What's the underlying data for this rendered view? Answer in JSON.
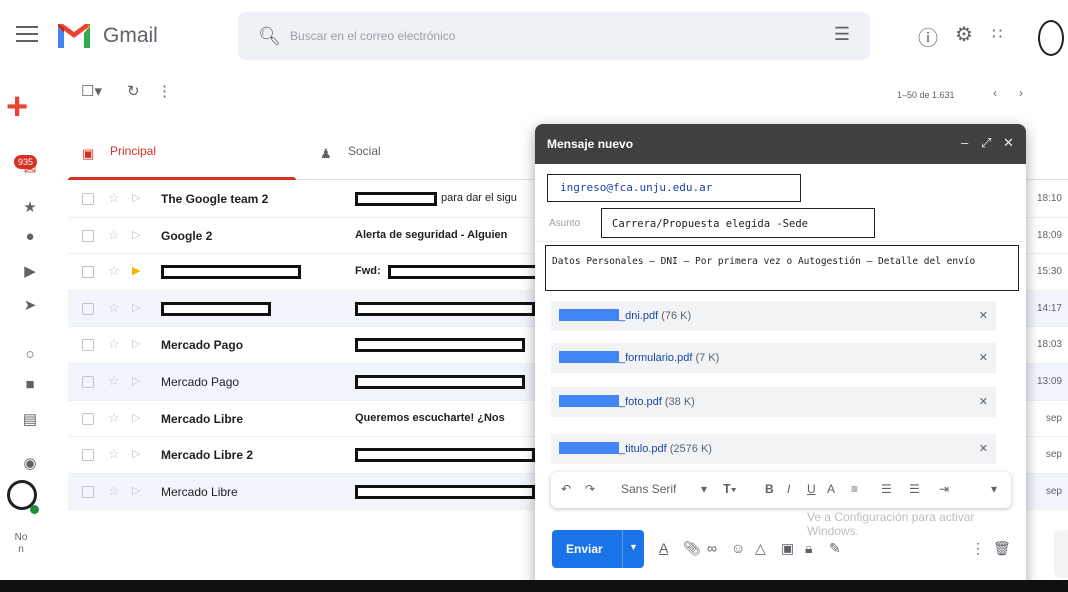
{
  "app": {
    "name": "Gmail"
  },
  "search": {
    "placeholder": "Buscar en el correo electrónico"
  },
  "left_rail": {
    "badge": "935",
    "footer_text": "No\nn"
  },
  "toolbar": {
    "pager": "1–50 de 1.631"
  },
  "tabs": [
    {
      "label": "Principal",
      "active": true
    },
    {
      "label": "Social",
      "active": false
    }
  ],
  "emails": [
    {
      "sender": "The Google team 2",
      "subject": "para dar el sigu",
      "time": "18:10",
      "read": false,
      "bold": true
    },
    {
      "sender": "Google 2",
      "subject": "Alerta de seguridad - Alguien",
      "time": "18:09",
      "read": false,
      "bold": true
    },
    {
      "sender": "",
      "subject": "Fwd:",
      "time": "15:30",
      "read": false,
      "bold": true,
      "important": true
    },
    {
      "sender": "",
      "subject": "",
      "time": "14:17",
      "read": true,
      "bold": false
    },
    {
      "sender": "Mercado Pago",
      "subject": "",
      "time": "18:03",
      "read": false,
      "bold": true
    },
    {
      "sender": "Mercado Pago",
      "subject": "",
      "time": "13:09",
      "read": true,
      "bold": false
    },
    {
      "sender": "Mercado Libre",
      "subject": "Queremos escucharte! ¿Nos",
      "time": "sep",
      "read": false,
      "bold": true
    },
    {
      "sender": "Mercado Libre 2",
      "subject": "",
      "time": "sep",
      "read": false,
      "bold": true
    },
    {
      "sender": "Mercado Libre",
      "subject": "",
      "time": "sep",
      "read": true,
      "bold": false
    }
  ],
  "compose": {
    "title": "Mensaje nuevo",
    "to": "ingreso@fca.unju.edu.ar",
    "subject_label": "Asunto",
    "subject": "Carrera/Propuesta elegida -Sede",
    "body": "Datos Personales – DNI – Por primera vez o Autogestión – Detalle del envío",
    "attachments": [
      {
        "name": "_dni.pdf",
        "size": "(76 K)"
      },
      {
        "name": "_formulario.pdf",
        "size": "(7 K)"
      },
      {
        "name": "_foto.pdf",
        "size": "(38 K)"
      },
      {
        "name": "_titulo.pdf",
        "size": "(2576 K)"
      }
    ],
    "font_name": "Sans Serif",
    "send_label": "Enviar",
    "activate_notice": "Ve a Configuración para activar Windows."
  },
  "colors": {
    "accent": "#1a73e8",
    "compose_header": "#404040",
    "tab_active": "#d93025"
  }
}
